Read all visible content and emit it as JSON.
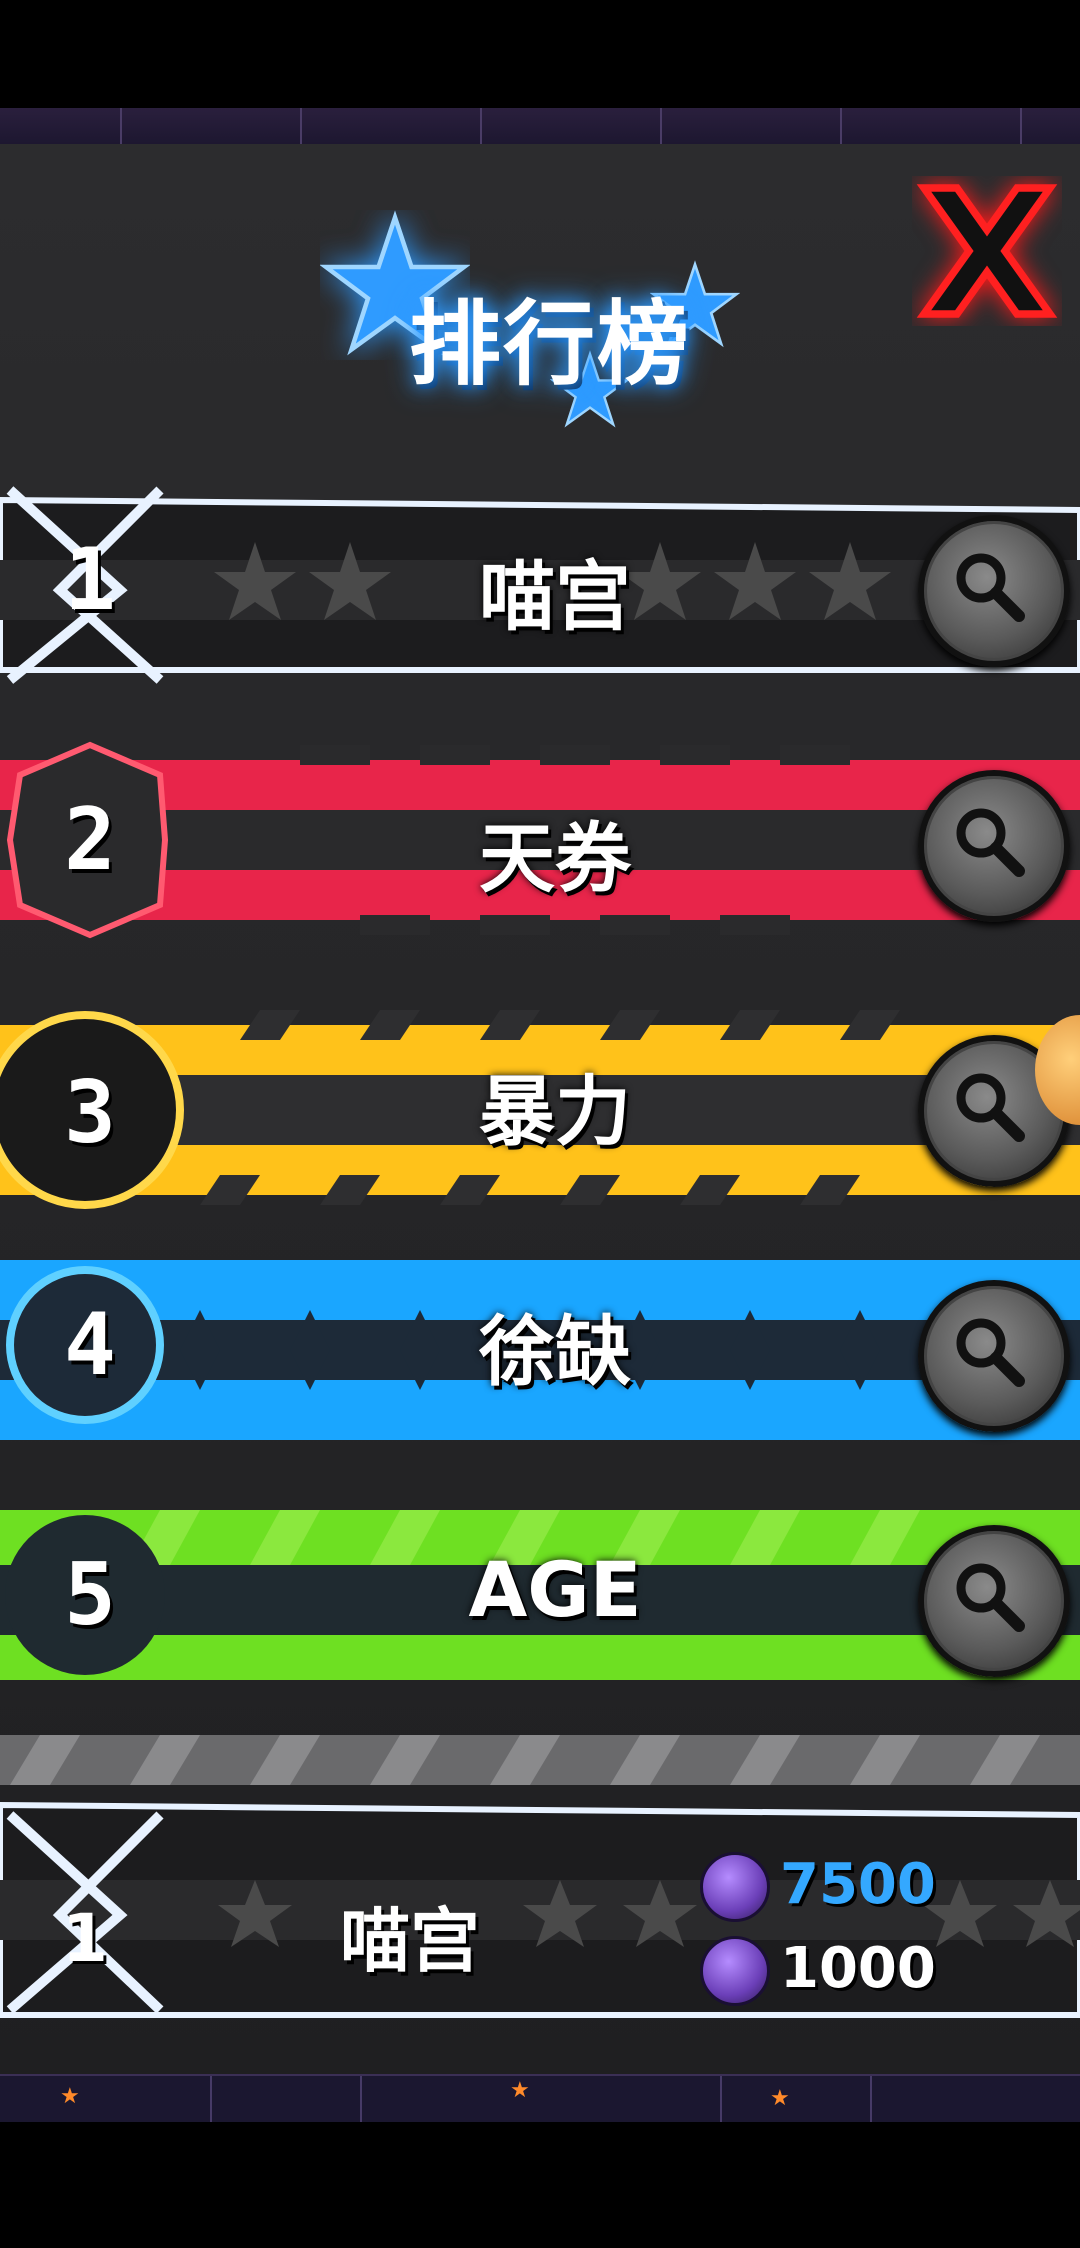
{
  "title": "排行榜",
  "close_icon": "close-x-icon",
  "colors": {
    "row1": "#1c1c1e",
    "row2": "#e8254a",
    "row3": "#ffc21a",
    "row4": "#1aa6ff",
    "row5": "#6ee022",
    "title_glow": "#2f9bff",
    "stat_blue": "#34a8ff"
  },
  "leaderboard": [
    {
      "rank": "1",
      "name": "喵宫"
    },
    {
      "rank": "2",
      "name": "天券"
    },
    {
      "rank": "3",
      "name": "暴力"
    },
    {
      "rank": "4",
      "name": "徐缺"
    },
    {
      "rank": "5",
      "name": "AGE"
    }
  ],
  "my_entry": {
    "rank": "1",
    "name": "喵宫",
    "score_primary": "7500",
    "score_secondary": "1000"
  }
}
